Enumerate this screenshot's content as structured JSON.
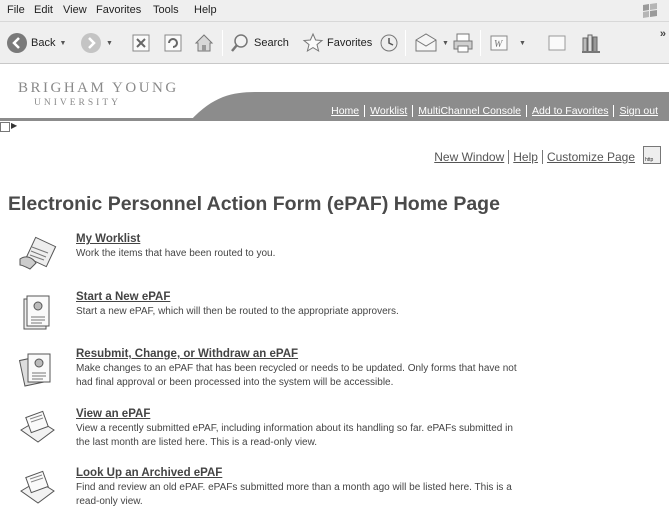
{
  "menu": [
    "File",
    "Edit",
    "View",
    "Favorites",
    "Tools",
    "Help"
  ],
  "toolbar": {
    "back_label": "Back",
    "search_label": "Search",
    "favorites_label": "Favorites"
  },
  "brand": {
    "line1": "BRIGHAM YOUNG",
    "line2": "UNIVERSITY"
  },
  "top_links": [
    "Home",
    "Worklist",
    "MultiChannel Console",
    "Add to Favorites",
    "Sign out"
  ],
  "util_links": [
    "New Window",
    "Help",
    "Customize Page"
  ],
  "page_title": "Electronic Personnel Action Form (ePAF) Home Page",
  "items": [
    {
      "link": "My Worklist",
      "desc": "Work the items that have been routed to you."
    },
    {
      "link": "Start a New ePAF",
      "desc": "Start a new ePAF, which will then be routed to the appropriate approvers."
    },
    {
      "link": "Resubmit, Change, or Withdraw an ePAF",
      "desc": "Make changes to an ePAF that has been recycled or needs to be updated. Only forms that have not had final approval or been processed into the system will be accessible."
    },
    {
      "link": "View an ePAF",
      "desc": "View a recently submitted ePAF, including information about its handling so far. ePAFs submitted in the last month are listed here. This is a read-only view."
    },
    {
      "link": "Look Up an Archived ePAF",
      "desc": "Find and review an old ePAF. ePAFs submitted more than a month ago will be listed here. This is a read-only view."
    }
  ],
  "icons": {
    "http": "http"
  }
}
